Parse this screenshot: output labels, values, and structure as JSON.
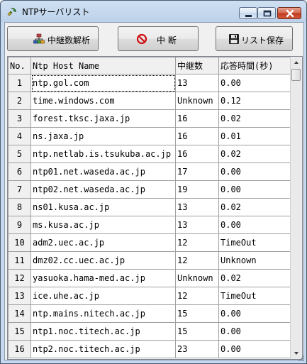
{
  "window": {
    "title": "NTPサーバリスト",
    "icons": {
      "app": "satellite-icon",
      "minimize": "minimize-icon",
      "maximize": "maximize-icon",
      "close": "close-icon"
    }
  },
  "toolbar": {
    "relay_analysis": {
      "label": "中継数解析",
      "icon": "network-tree-icon"
    },
    "stop": {
      "label": "中 断",
      "icon": "prohibited-icon"
    },
    "save_list": {
      "label": "リスト保存",
      "icon": "floppy-disk-icon"
    }
  },
  "grid": {
    "columns": [
      "No.",
      "Ntp Host Name",
      "中継数",
      "応答時間(秒)"
    ],
    "rows": [
      {
        "no": "1",
        "host": "ntp.gol.com",
        "relays": "13",
        "response": "0.00"
      },
      {
        "no": "2",
        "host": "time.windows.com",
        "relays": "Unknown",
        "response": "0.12"
      },
      {
        "no": "3",
        "host": "forest.tksc.jaxa.jp",
        "relays": "16",
        "response": "0.02"
      },
      {
        "no": "4",
        "host": "ns.jaxa.jp",
        "relays": "16",
        "response": "0.01"
      },
      {
        "no": "5",
        "host": "ntp.netlab.is.tsukuba.ac.jp",
        "relays": "16",
        "response": "0.02"
      },
      {
        "no": "6",
        "host": "ntp01.net.waseda.ac.jp",
        "relays": "17",
        "response": "0.00"
      },
      {
        "no": "7",
        "host": "ntp02.net.waseda.ac.jp",
        "relays": "19",
        "response": "0.00"
      },
      {
        "no": "8",
        "host": "ns01.kusa.ac.jp",
        "relays": "13",
        "response": "0.02"
      },
      {
        "no": "9",
        "host": "ms.kusa.ac.jp",
        "relays": "13",
        "response": "0.00"
      },
      {
        "no": "10",
        "host": "adm2.uec.ac.jp",
        "relays": "12",
        "response": "TimeOut"
      },
      {
        "no": "11",
        "host": "dmz02.cc.uec.ac.jp",
        "relays": "12",
        "response": "Unknown"
      },
      {
        "no": "12",
        "host": "yasuoka.hama-med.ac.jp",
        "relays": "Unknown",
        "response": "0.02"
      },
      {
        "no": "13",
        "host": "ice.uhe.ac.jp",
        "relays": "12",
        "response": "TimeOut"
      },
      {
        "no": "14",
        "host": "ntp.mains.nitech.ac.jp",
        "relays": "15",
        "response": "0.00"
      },
      {
        "no": "15",
        "host": "ntp1.noc.titech.ac.jp",
        "relays": "15",
        "response": "0.00"
      },
      {
        "no": "16",
        "host": "ntp2.noc.titech.ac.jp",
        "relays": "23",
        "response": "0.00"
      }
    ]
  }
}
